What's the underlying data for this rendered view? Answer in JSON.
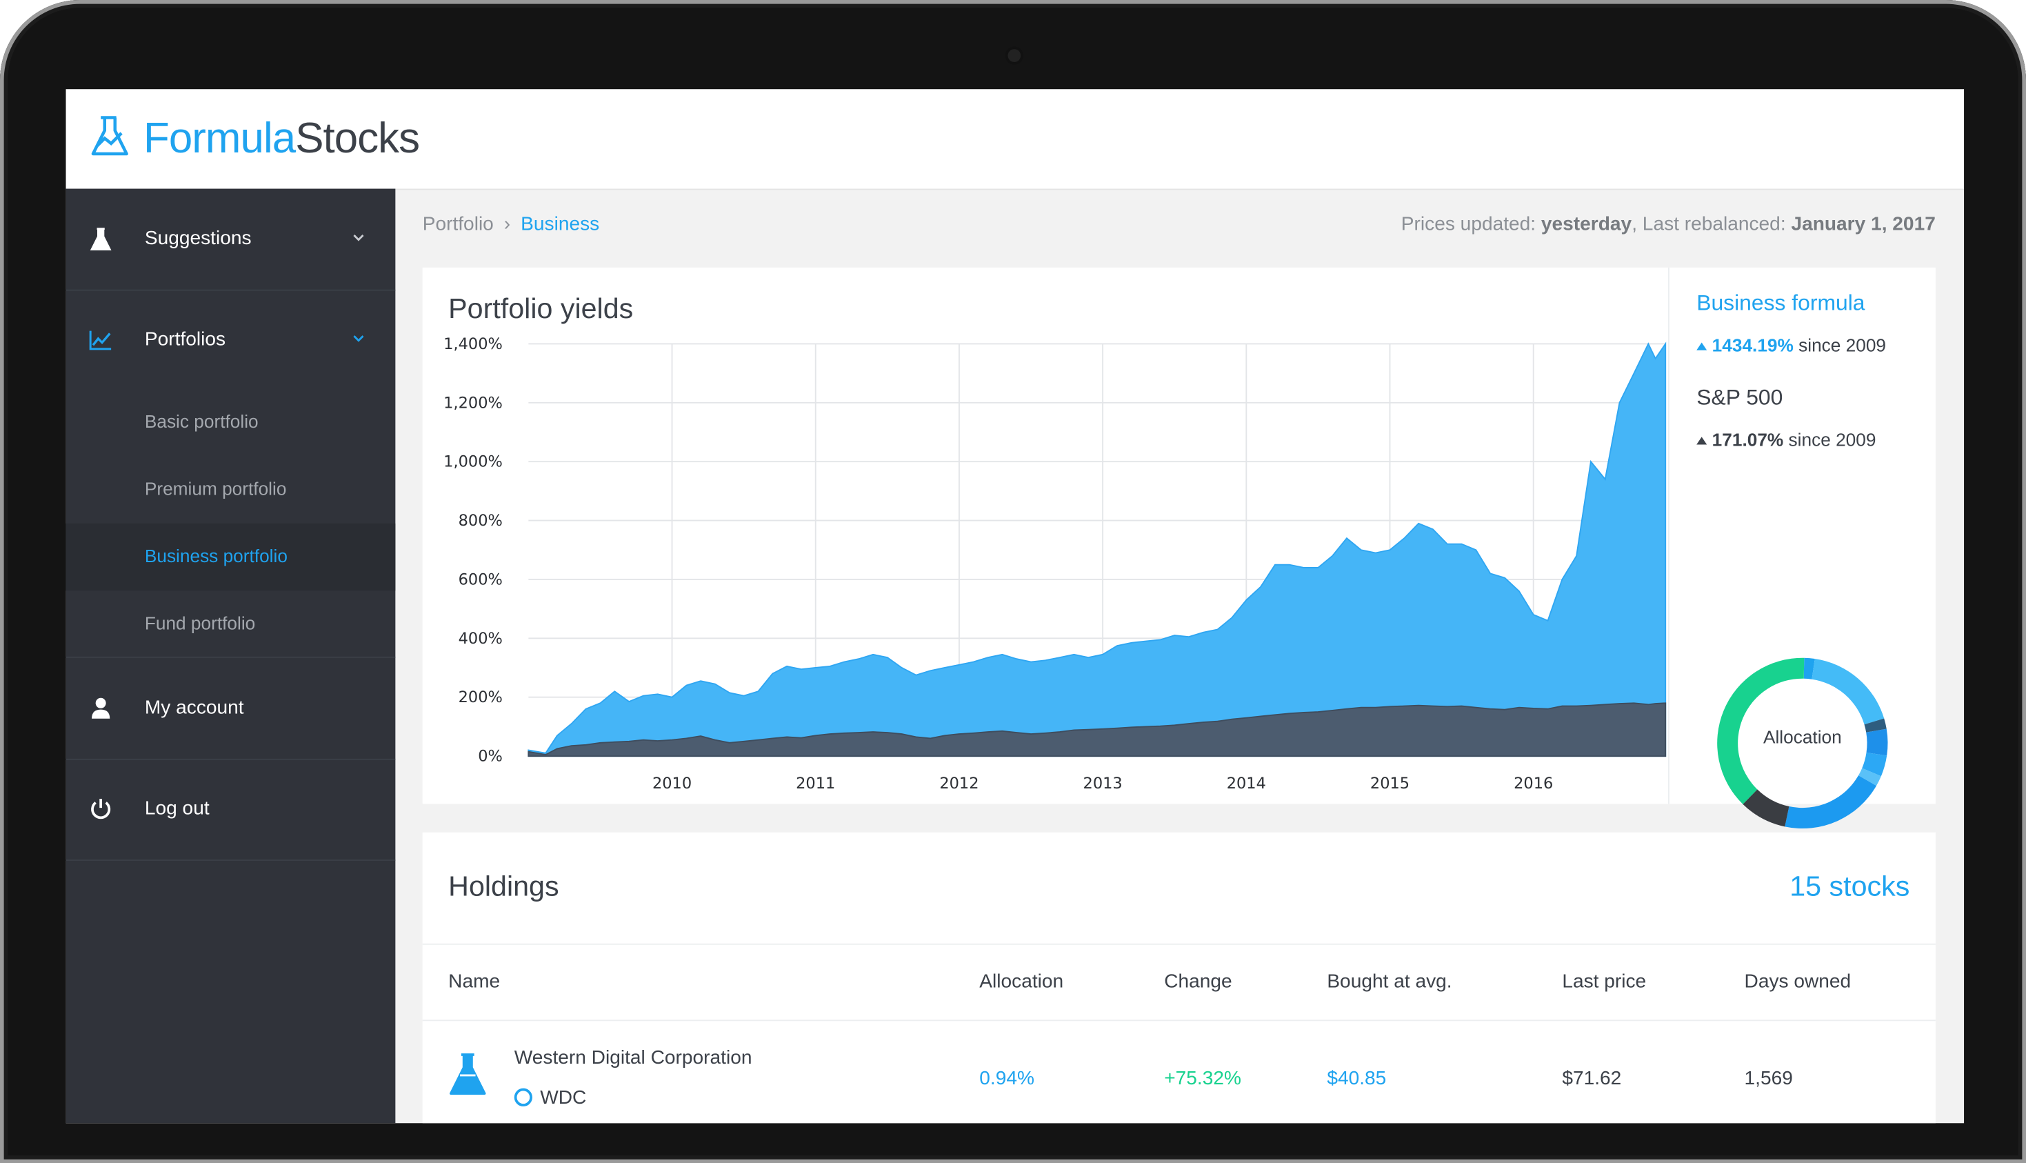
{
  "brand": {
    "name_part1": "Formula",
    "name_part2": "Stocks",
    "accent": "#1fa3ef"
  },
  "sidebar": {
    "items": [
      {
        "label": "Suggestions",
        "icon": "flask-icon"
      },
      {
        "label": "Portfolios",
        "icon": "chart-line-icon"
      },
      {
        "label": "My account",
        "icon": "user-icon"
      },
      {
        "label": "Log out",
        "icon": "power-icon"
      }
    ],
    "portfolio_subitems": [
      {
        "label": "Basic portfolio"
      },
      {
        "label": "Premium portfolio"
      },
      {
        "label": "Business portfolio",
        "active": true
      },
      {
        "label": "Fund portfolio"
      }
    ]
  },
  "breadcrumb": {
    "root": "Portfolio",
    "current": "Business"
  },
  "status": {
    "prices_label": "Prices updated:",
    "prices_value": "yesterday",
    "rebalance_label": ", Last rebalanced:",
    "rebalance_value": "January 1, 2017"
  },
  "yields_card": {
    "title": "Portfolio yields",
    "formula_title": "Business formula",
    "formula_change": "1434.19%",
    "formula_since": "since 2009",
    "benchmark_title": "S&P 500",
    "benchmark_change": "171.07%",
    "benchmark_since": "since 2009",
    "donut_label": "Allocation"
  },
  "chart_data": {
    "type": "area",
    "title": "Portfolio yields",
    "xlabel": "",
    "ylabel": "",
    "x_ticks": [
      "2010",
      "2011",
      "2012",
      "2013",
      "2014",
      "2015",
      "2016"
    ],
    "y_ticks": [
      "0%",
      "200%",
      "400%",
      "600%",
      "800%",
      "1,000%",
      "1,200%",
      "1,400%"
    ],
    "ylim": [
      0,
      1400
    ],
    "xlim": [
      2009.0,
      2016.92
    ],
    "grid": true,
    "series": [
      {
        "color": "#45b5f7",
        "x": [
          2009.0,
          2009.12,
          2009.2,
          2009.3,
          2009.4,
          2009.5,
          2009.6,
          2009.7,
          2009.8,
          2009.9,
          2010.0,
          2010.1,
          2010.2,
          2010.3,
          2010.4,
          2010.5,
          2010.6,
          2010.7,
          2010.8,
          2010.9,
          2011.0,
          2011.1,
          2011.2,
          2011.3,
          2011.4,
          2011.5,
          2011.6,
          2011.7,
          2011.8,
          2011.9,
          2012.0,
          2012.1,
          2012.2,
          2012.3,
          2012.4,
          2012.5,
          2012.6,
          2012.7,
          2012.8,
          2012.9,
          2013.0,
          2013.1,
          2013.2,
          2013.3,
          2013.4,
          2013.5,
          2013.6,
          2013.7,
          2013.8,
          2013.9,
          2014.0,
          2014.1,
          2014.2,
          2014.3,
          2014.4,
          2014.5,
          2014.6,
          2014.7,
          2014.8,
          2014.9,
          2015.0,
          2015.1,
          2015.2,
          2015.3,
          2015.4,
          2015.5,
          2015.6,
          2015.7,
          2015.8,
          2015.9,
          2016.0,
          2016.1,
          2016.2,
          2016.3,
          2016.4,
          2016.5,
          2016.6,
          2016.7,
          2016.8,
          2016.85,
          2016.92
        ],
        "values": [
          20,
          10,
          70,
          110,
          160,
          180,
          220,
          185,
          205,
          210,
          200,
          240,
          255,
          245,
          215,
          205,
          220,
          280,
          305,
          295,
          300,
          305,
          320,
          330,
          345,
          335,
          300,
          275,
          290,
          300,
          310,
          320,
          335,
          345,
          330,
          320,
          325,
          335,
          345,
          335,
          345,
          375,
          385,
          390,
          395,
          410,
          405,
          420,
          430,
          470,
          530,
          575,
          650,
          650,
          640,
          640,
          680,
          740,
          700,
          690,
          700,
          740,
          790,
          770,
          720,
          720,
          700,
          620,
          605,
          560,
          480,
          460,
          600,
          680,
          1000,
          940,
          1200,
          1300,
          1400,
          1350,
          1400
        ]
      },
      {
        "color": "#4c5c6f",
        "x": [
          2009.0,
          2009.12,
          2009.2,
          2009.3,
          2009.4,
          2009.5,
          2009.6,
          2009.7,
          2009.8,
          2009.9,
          2010.0,
          2010.1,
          2010.2,
          2010.3,
          2010.4,
          2010.5,
          2010.6,
          2010.7,
          2010.8,
          2010.9,
          2011.0,
          2011.1,
          2011.2,
          2011.3,
          2011.4,
          2011.5,
          2011.6,
          2011.7,
          2011.8,
          2011.9,
          2012.0,
          2012.1,
          2012.2,
          2012.3,
          2012.4,
          2012.5,
          2012.6,
          2012.7,
          2012.8,
          2012.9,
          2013.0,
          2013.1,
          2013.2,
          2013.3,
          2013.4,
          2013.5,
          2013.6,
          2013.7,
          2013.8,
          2013.9,
          2014.0,
          2014.1,
          2014.2,
          2014.3,
          2014.4,
          2014.5,
          2014.6,
          2014.7,
          2014.8,
          2014.9,
          2015.0,
          2015.1,
          2015.2,
          2015.3,
          2015.4,
          2015.5,
          2015.6,
          2015.7,
          2015.8,
          2015.9,
          2016.0,
          2016.1,
          2016.2,
          2016.3,
          2016.4,
          2016.5,
          2016.6,
          2016.7,
          2016.8,
          2016.85,
          2016.92
        ],
        "values": [
          15,
          5,
          25,
          35,
          38,
          45,
          48,
          50,
          55,
          52,
          55,
          60,
          68,
          55,
          45,
          50,
          55,
          60,
          65,
          62,
          70,
          75,
          78,
          80,
          82,
          80,
          75,
          65,
          60,
          70,
          75,
          78,
          82,
          85,
          80,
          75,
          78,
          82,
          88,
          90,
          92,
          95,
          98,
          100,
          102,
          105,
          110,
          115,
          118,
          125,
          130,
          135,
          140,
          145,
          148,
          150,
          155,
          160,
          165,
          165,
          168,
          170,
          172,
          170,
          168,
          170,
          165,
          160,
          158,
          165,
          162,
          160,
          170,
          170,
          172,
          175,
          178,
          180,
          175,
          178,
          180
        ]
      }
    ]
  },
  "allocation_donut": {
    "segments": [
      {
        "color": "#1fa3ef",
        "pct": 2
      },
      {
        "color": "#44bbf7",
        "pct": 18
      },
      {
        "color": "#2e5d7f",
        "pct": 2
      },
      {
        "color": "#1e90ea",
        "pct": 5
      },
      {
        "color": "#2ca8f5",
        "pct": 4
      },
      {
        "color": "#5ac1f8",
        "pct": 2
      },
      {
        "color": "#1c9af0",
        "pct": 20
      },
      {
        "color": "#3a3d42",
        "pct": 9
      },
      {
        "color": "#18d28f",
        "pct": 38
      }
    ]
  },
  "holdings": {
    "title": "Holdings",
    "count": "15 stocks",
    "columns": [
      "Name",
      "Allocation",
      "Change",
      "Bought at avg.",
      "Last price",
      "Days owned"
    ],
    "rows": [
      {
        "name": "Western Digital Corporation",
        "ticker": "WDC",
        "allocation": "0.94%",
        "change": "+75.32%",
        "bought_avg": "$40.85",
        "last_price": "$71.62",
        "days_owned": "1,569",
        "icon": "flask-icon"
      }
    ]
  }
}
